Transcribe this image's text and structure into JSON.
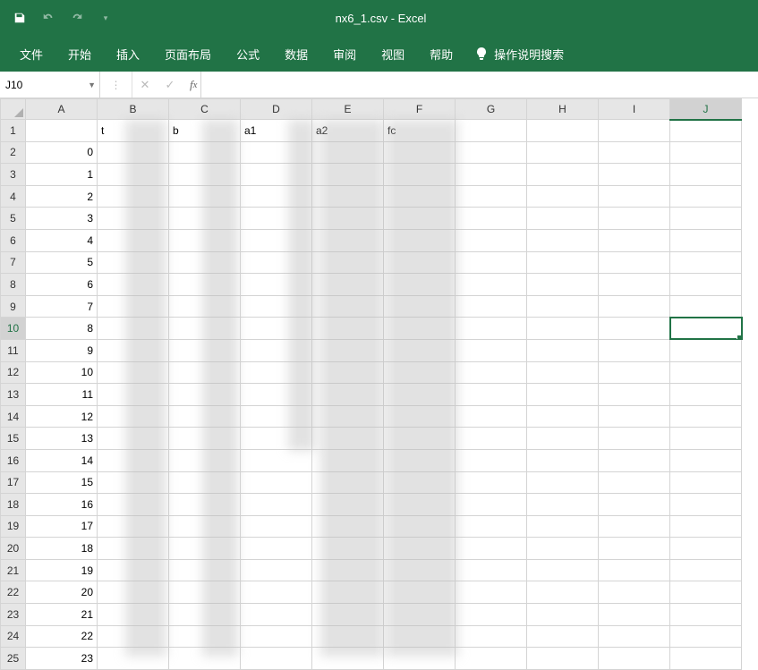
{
  "title": "nx6_1.csv  -  Excel",
  "ribbon": {
    "tabs": [
      "文件",
      "开始",
      "插入",
      "页面布局",
      "公式",
      "数据",
      "审阅",
      "视图",
      "帮助"
    ],
    "tellme": "操作说明搜索"
  },
  "nameBox": "J10",
  "formula": "",
  "columns": [
    "A",
    "B",
    "C",
    "D",
    "E",
    "F",
    "G",
    "H",
    "I",
    "J"
  ],
  "activeCell": {
    "row": 10,
    "col": "J"
  },
  "headerRow": {
    "A": "",
    "B": "t",
    "C": "b",
    "D": "a1",
    "E": "a2",
    "F": "fc",
    "G": "",
    "H": "",
    "I": "",
    "J": ""
  },
  "dataRows": [
    {
      "A": "0"
    },
    {
      "A": "1"
    },
    {
      "A": "2"
    },
    {
      "A": "3"
    },
    {
      "A": "4"
    },
    {
      "A": "5"
    },
    {
      "A": "6"
    },
    {
      "A": "7"
    },
    {
      "A": "8"
    },
    {
      "A": "9"
    },
    {
      "A": "10"
    },
    {
      "A": "11"
    },
    {
      "A": "12"
    },
    {
      "A": "13"
    },
    {
      "A": "14"
    },
    {
      "A": "15"
    },
    {
      "A": "16"
    },
    {
      "A": "17"
    },
    {
      "A": "18"
    },
    {
      "A": "19"
    },
    {
      "A": "20"
    },
    {
      "A": "21"
    },
    {
      "A": "22"
    },
    {
      "A": "23"
    }
  ]
}
